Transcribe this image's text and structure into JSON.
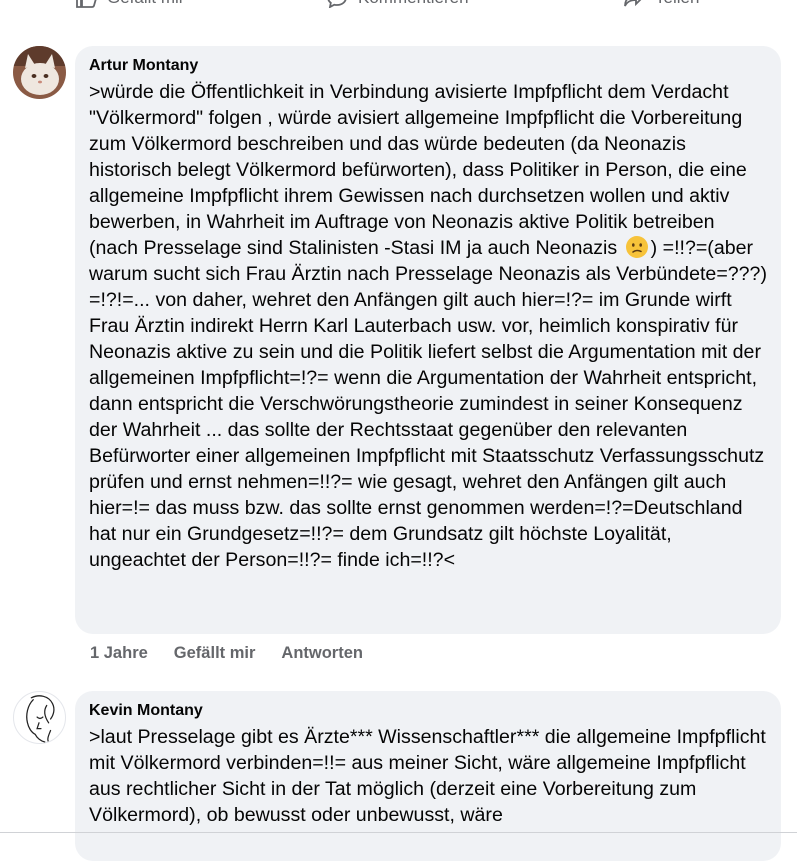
{
  "top_actions": {
    "like": "Gefällt mir",
    "comment": "Kommentieren",
    "share": "Teilen"
  },
  "comments": [
    {
      "author": "Artur Montany",
      "text_before_emoji": ">würde die Öffentlichkeit in Verbindung avisierte Impfpflicht  dem Verdacht \"Völkermord\" folgen , würde  avisiert allgemeine Impfpflicht die Vorbereitung zum Völkermord beschreiben und das würde bedeuten (da Neonazis historisch belegt Völkermord befürworten), dass Politiker in Person, die eine allgemeine Impfpflicht ihrem Gewissen nach durchsetzen wollen und aktiv bewerben, in Wahrheit im Auftrage von Neonazis aktive Politik betreiben (nach Presselage sind Stalinisten -Stasi IM ja auch Neonazis",
      "emoji": "confused-face",
      "text_after_emoji": ") =!!?=(aber warum sucht sich Frau Ärztin nach Presselage Neonazis als Verbündete=???) =!?!=... von daher, wehret den Anfängen gilt auch hier=!?= im Grunde wirft Frau Ärztin indirekt Herrn Karl Lauterbach usw. vor, heimlich konspirativ für Neonazis aktive zu sein und die Politik liefert selbst die Argumentation mit der allgemeinen Impfpflicht=!?= wenn die Argumentation der Wahrheit entspricht, dann entspricht die Verschwörungstheorie zumindest in seiner Konsequenz der Wahrheit ... das sollte der Rechtsstaat gegenüber den relevanten Befürworter einer allgemeinen Impfpflicht  mit Staatsschutz Verfassungsschutz prüfen und ernst nehmen=!!?= wie gesagt, wehret den Anfängen gilt auch hier=!= das muss bzw. das sollte  ernst genommen werden=!?=Deutschland hat nur ein Grundgesetz=!!?= dem Grundsatz gilt höchste Loyalität, ungeachtet der Person=!!?=  finde ich=!!?<",
      "time": "1 Jahre",
      "like_label": "Gefällt mir",
      "reply_label": "Antworten"
    },
    {
      "author": "Kevin Montany",
      "text": ">laut Presselage gibt es Ärzte*** Wissenschaftler***  die allgemeine Impfpflicht mit Völkermord verbinden=!!= aus meiner Sicht, wäre allgemeine Impfpflicht aus rechtlicher Sicht in der Tat möglich (derzeit eine Vorbereitung zum Völkermord), ob bewusst oder unbewusst, wäre"
    }
  ],
  "colors": {
    "bubble": "#f0f2f5",
    "meta_text": "#65676b",
    "text": "#050505",
    "emoji": "#f7c33a"
  }
}
